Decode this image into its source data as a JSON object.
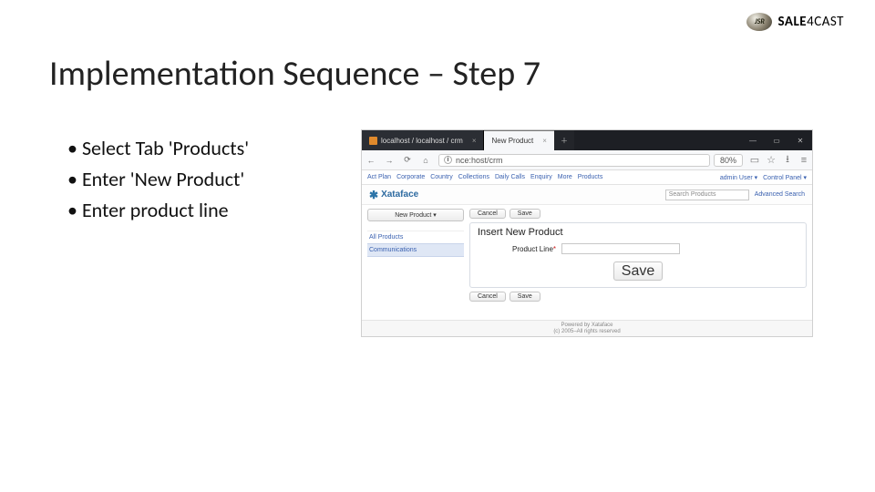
{
  "logo": {
    "badge": "JSR",
    "text_bold": "SALE",
    "text_mid": "4",
    "text_thin": "CAST"
  },
  "title": "Implementation Sequence – Step 7",
  "bullets": [
    "Select Tab 'Products'",
    "Enter 'New Product'",
    "Enter product line"
  ],
  "browser": {
    "tab1": "localhost / localhost / crm",
    "tab2": "New Product",
    "url_text": "nce:host/crm",
    "zoom": "80%",
    "winbuttons": {
      "min": "—",
      "max": "▭",
      "close": "✕"
    }
  },
  "appnav": {
    "items": [
      "Act Plan",
      "Corporate",
      "Country",
      "Collections",
      "Daily Calls",
      "Enquiry",
      "More",
      "Products"
    ],
    "user": "admin User ▾",
    "panel": "Control Panel ▾"
  },
  "apphead": {
    "brand": "Xataface",
    "search_placeholder": "Search Products",
    "advanced": "Advanced Search"
  },
  "leftcol": {
    "newbtn": "New Product ▾",
    "cat_all": "All Products",
    "cat_sel": "Communications"
  },
  "form": {
    "btn_cancel": "Cancel",
    "btn_save": "Save",
    "heading": "Insert New Product",
    "field_label": "Product Line",
    "required_mark": "*"
  },
  "footer": {
    "line1": "Powered by Xataface",
    "line2": "(c) 2005–All rights reserved"
  }
}
